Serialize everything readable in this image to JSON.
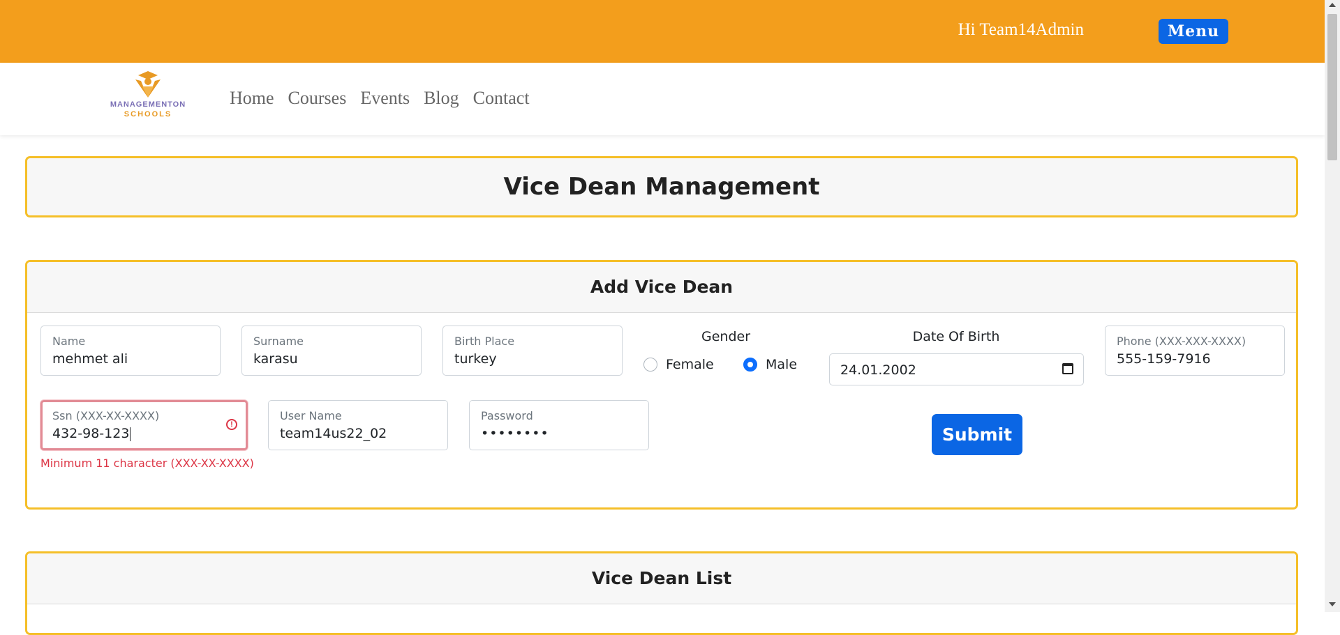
{
  "header": {
    "greeting": "Hi Team14Admin",
    "menu_label": "Menu",
    "bg_color": "#f39e1c",
    "accent": "#0b66e4"
  },
  "brand": {
    "line1": "MANAGEMENTON",
    "line2": "SCHOOLS"
  },
  "nav": {
    "items": [
      "Home",
      "Courses",
      "Events",
      "Blog",
      "Contact"
    ]
  },
  "page_title": "Vice Dean Management",
  "add_form": {
    "title": "Add Vice Dean",
    "name": {
      "label": "Name",
      "value": "mehmet ali"
    },
    "surname": {
      "label": "Surname",
      "value": "karasu"
    },
    "birth_place": {
      "label": "Birth Place",
      "value": "turkey"
    },
    "gender": {
      "label": "Gender",
      "options": [
        "Female",
        "Male"
      ],
      "selected": "Male"
    },
    "date_of_birth": {
      "label": "Date Of Birth",
      "value": "24.01.2002"
    },
    "phone": {
      "label": "Phone (XXX-XXX-XXXX)",
      "value": "555-159-7916"
    },
    "ssn": {
      "label": "Ssn (XXX-XX-XXXX)",
      "value": "432-98-123",
      "error": "Minimum 11 character (XXX-XX-XXXX)"
    },
    "username": {
      "label": "User Name",
      "value": "team14us22_02"
    },
    "password": {
      "label": "Password",
      "value": "••••••••"
    },
    "submit_label": "Submit"
  },
  "list": {
    "title": "Vice Dean List"
  },
  "border_color": "#f5bf29",
  "error_color": "#dc3545"
}
